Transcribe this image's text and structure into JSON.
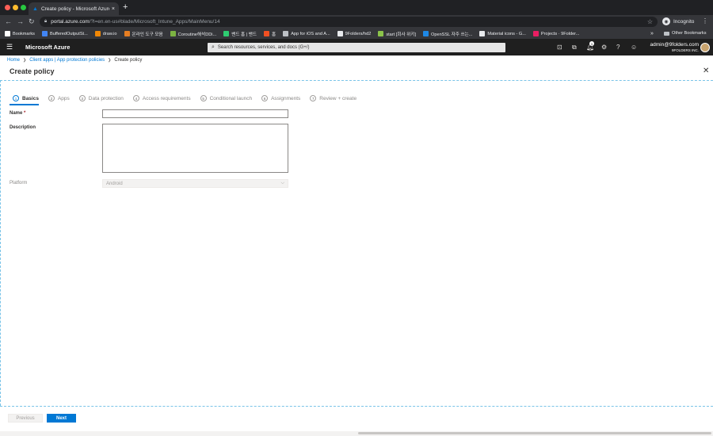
{
  "browser": {
    "tab_title": "Create policy - Microsoft Azure",
    "tab_close": "×",
    "new_tab": "+",
    "url_host": "portal.azure.com",
    "url_path": "/?l=en.en-us#blade/Microsoft_Intune_Apps/MainMenu/14",
    "incognito_label": "Incognito",
    "bookmarks": [
      {
        "label": "Bookmarks",
        "color": "#ffffff"
      },
      {
        "label": "BufferedOutputSt...",
        "color": "#4285f4"
      },
      {
        "label": "draw.io",
        "color": "#f08705"
      },
      {
        "label": "온라인 도구 모음",
        "color": "#e67e22"
      },
      {
        "label": "Coroutine해석DDi...",
        "color": "#7cb342"
      },
      {
        "label": "밴드 홈 | 밴드",
        "color": "#2ecc71"
      },
      {
        "label": "홈",
        "color": "#f25022"
      },
      {
        "label": "App for iOS and A...",
        "color": "#bdc1c6"
      },
      {
        "label": "9Folders/hd2",
        "color": "#e8eaed"
      },
      {
        "label": "start [회사 위키]",
        "color": "#8bc34a"
      },
      {
        "label": "OpenSSL 자주 쓰는...",
        "color": "#1e88e5"
      },
      {
        "label": "Material icons - G...",
        "color": "#e8eaed"
      },
      {
        "label": "Projects · 9Folder...",
        "color": "#e91e63"
      }
    ],
    "more": "»",
    "other_bookmarks": "Other Bookmarks"
  },
  "azure": {
    "brand": "Microsoft Azure",
    "search_placeholder": "Search resources, services, and docs (G+/)",
    "notification_count": "1",
    "account_name": "admin@9folders.com",
    "account_org": "9FOLDERS INC."
  },
  "breadcrumb": {
    "home": "Home",
    "client_apps": "Client apps | App protection policies",
    "current": "Create policy"
  },
  "page": {
    "title": "Create policy"
  },
  "steps": [
    {
      "num": "1",
      "label": "Basics",
      "active": true
    },
    {
      "num": "2",
      "label": "Apps"
    },
    {
      "num": "3",
      "label": "Data protection"
    },
    {
      "num": "4",
      "label": "Access requirements"
    },
    {
      "num": "5",
      "label": "Conditional launch"
    },
    {
      "num": "6",
      "label": "Assignments"
    },
    {
      "num": "7",
      "label": "Review + create"
    }
  ],
  "form": {
    "name_label": "Name",
    "required_mark": "*",
    "name_value": "",
    "description_label": "Description",
    "description_value": "",
    "platform_label": "Platform",
    "platform_value": "Android"
  },
  "footer": {
    "previous": "Previous",
    "next": "Next"
  }
}
